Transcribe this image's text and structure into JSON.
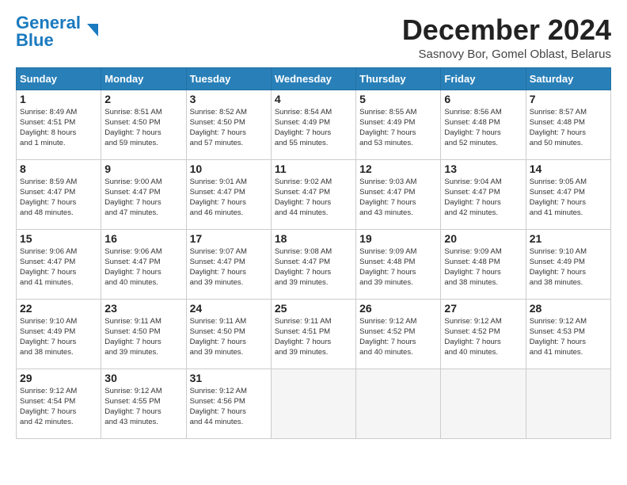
{
  "header": {
    "logo_line1": "General",
    "logo_line2": "Blue",
    "title": "December 2024",
    "location": "Sasnovy Bor, Gomel Oblast, Belarus"
  },
  "columns": [
    "Sunday",
    "Monday",
    "Tuesday",
    "Wednesday",
    "Thursday",
    "Friday",
    "Saturday"
  ],
  "weeks": [
    [
      {
        "day": "1",
        "info": "Sunrise: 8:49 AM\nSunset: 4:51 PM\nDaylight: 8 hours\nand 1 minute."
      },
      {
        "day": "2",
        "info": "Sunrise: 8:51 AM\nSunset: 4:50 PM\nDaylight: 7 hours\nand 59 minutes."
      },
      {
        "day": "3",
        "info": "Sunrise: 8:52 AM\nSunset: 4:50 PM\nDaylight: 7 hours\nand 57 minutes."
      },
      {
        "day": "4",
        "info": "Sunrise: 8:54 AM\nSunset: 4:49 PM\nDaylight: 7 hours\nand 55 minutes."
      },
      {
        "day": "5",
        "info": "Sunrise: 8:55 AM\nSunset: 4:49 PM\nDaylight: 7 hours\nand 53 minutes."
      },
      {
        "day": "6",
        "info": "Sunrise: 8:56 AM\nSunset: 4:48 PM\nDaylight: 7 hours\nand 52 minutes."
      },
      {
        "day": "7",
        "info": "Sunrise: 8:57 AM\nSunset: 4:48 PM\nDaylight: 7 hours\nand 50 minutes."
      }
    ],
    [
      {
        "day": "8",
        "info": "Sunrise: 8:59 AM\nSunset: 4:47 PM\nDaylight: 7 hours\nand 48 minutes."
      },
      {
        "day": "9",
        "info": "Sunrise: 9:00 AM\nSunset: 4:47 PM\nDaylight: 7 hours\nand 47 minutes."
      },
      {
        "day": "10",
        "info": "Sunrise: 9:01 AM\nSunset: 4:47 PM\nDaylight: 7 hours\nand 46 minutes."
      },
      {
        "day": "11",
        "info": "Sunrise: 9:02 AM\nSunset: 4:47 PM\nDaylight: 7 hours\nand 44 minutes."
      },
      {
        "day": "12",
        "info": "Sunrise: 9:03 AM\nSunset: 4:47 PM\nDaylight: 7 hours\nand 43 minutes."
      },
      {
        "day": "13",
        "info": "Sunrise: 9:04 AM\nSunset: 4:47 PM\nDaylight: 7 hours\nand 42 minutes."
      },
      {
        "day": "14",
        "info": "Sunrise: 9:05 AM\nSunset: 4:47 PM\nDaylight: 7 hours\nand 41 minutes."
      }
    ],
    [
      {
        "day": "15",
        "info": "Sunrise: 9:06 AM\nSunset: 4:47 PM\nDaylight: 7 hours\nand 41 minutes."
      },
      {
        "day": "16",
        "info": "Sunrise: 9:06 AM\nSunset: 4:47 PM\nDaylight: 7 hours\nand 40 minutes."
      },
      {
        "day": "17",
        "info": "Sunrise: 9:07 AM\nSunset: 4:47 PM\nDaylight: 7 hours\nand 39 minutes."
      },
      {
        "day": "18",
        "info": "Sunrise: 9:08 AM\nSunset: 4:47 PM\nDaylight: 7 hours\nand 39 minutes."
      },
      {
        "day": "19",
        "info": "Sunrise: 9:09 AM\nSunset: 4:48 PM\nDaylight: 7 hours\nand 39 minutes."
      },
      {
        "day": "20",
        "info": "Sunrise: 9:09 AM\nSunset: 4:48 PM\nDaylight: 7 hours\nand 38 minutes."
      },
      {
        "day": "21",
        "info": "Sunrise: 9:10 AM\nSunset: 4:49 PM\nDaylight: 7 hours\nand 38 minutes."
      }
    ],
    [
      {
        "day": "22",
        "info": "Sunrise: 9:10 AM\nSunset: 4:49 PM\nDaylight: 7 hours\nand 38 minutes."
      },
      {
        "day": "23",
        "info": "Sunrise: 9:11 AM\nSunset: 4:50 PM\nDaylight: 7 hours\nand 39 minutes."
      },
      {
        "day": "24",
        "info": "Sunrise: 9:11 AM\nSunset: 4:50 PM\nDaylight: 7 hours\nand 39 minutes."
      },
      {
        "day": "25",
        "info": "Sunrise: 9:11 AM\nSunset: 4:51 PM\nDaylight: 7 hours\nand 39 minutes."
      },
      {
        "day": "26",
        "info": "Sunrise: 9:12 AM\nSunset: 4:52 PM\nDaylight: 7 hours\nand 40 minutes."
      },
      {
        "day": "27",
        "info": "Sunrise: 9:12 AM\nSunset: 4:52 PM\nDaylight: 7 hours\nand 40 minutes."
      },
      {
        "day": "28",
        "info": "Sunrise: 9:12 AM\nSunset: 4:53 PM\nDaylight: 7 hours\nand 41 minutes."
      }
    ],
    [
      {
        "day": "29",
        "info": "Sunrise: 9:12 AM\nSunset: 4:54 PM\nDaylight: 7 hours\nand 42 minutes."
      },
      {
        "day": "30",
        "info": "Sunrise: 9:12 AM\nSunset: 4:55 PM\nDaylight: 7 hours\nand 43 minutes."
      },
      {
        "day": "31",
        "info": "Sunrise: 9:12 AM\nSunset: 4:56 PM\nDaylight: 7 hours\nand 44 minutes."
      },
      {
        "day": "",
        "info": ""
      },
      {
        "day": "",
        "info": ""
      },
      {
        "day": "",
        "info": ""
      },
      {
        "day": "",
        "info": ""
      }
    ]
  ]
}
